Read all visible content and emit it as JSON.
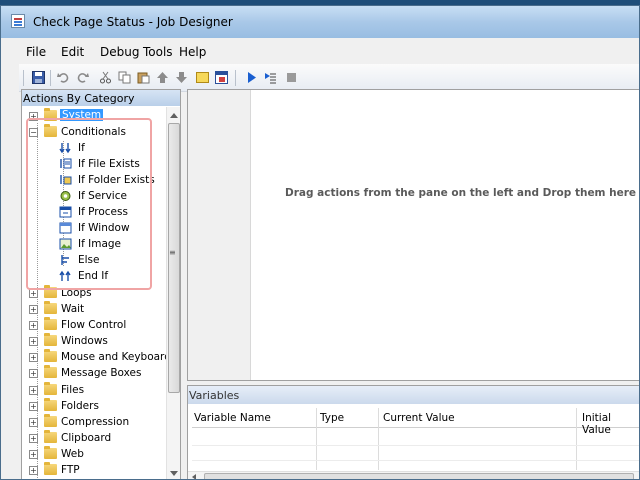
{
  "window": {
    "title": "Check Page Status - Job Designer"
  },
  "menu": [
    "File",
    "Edit",
    "Debug",
    "Tools",
    "Help"
  ],
  "actions_panel": {
    "header": "Actions By Category",
    "tree": [
      {
        "label": "System",
        "expanded": false,
        "selected": true
      },
      {
        "label": "Conditionals",
        "expanded": true,
        "children": [
          "If",
          "If File Exists",
          "If Folder Exists",
          "If Service",
          "If Process",
          "If Window",
          "If Image",
          "Else",
          "End If"
        ]
      },
      {
        "label": "Loops"
      },
      {
        "label": "Wait"
      },
      {
        "label": "Flow Control"
      },
      {
        "label": "Windows"
      },
      {
        "label": "Mouse and Keyboard"
      },
      {
        "label": "Message Boxes"
      },
      {
        "label": "Files"
      },
      {
        "label": "Folders"
      },
      {
        "label": "Compression"
      },
      {
        "label": "Clipboard"
      },
      {
        "label": "Web"
      },
      {
        "label": "FTP"
      }
    ]
  },
  "designer": {
    "hint": "Drag actions from the pane on the left and Drop them here"
  },
  "variables": {
    "header": "Variables",
    "columns": [
      "Variable Name",
      "Type",
      "Current Value",
      "Initial Value"
    ]
  },
  "colors": {
    "selection": "#3399ff",
    "highlight_box": "#f0a4a4"
  }
}
